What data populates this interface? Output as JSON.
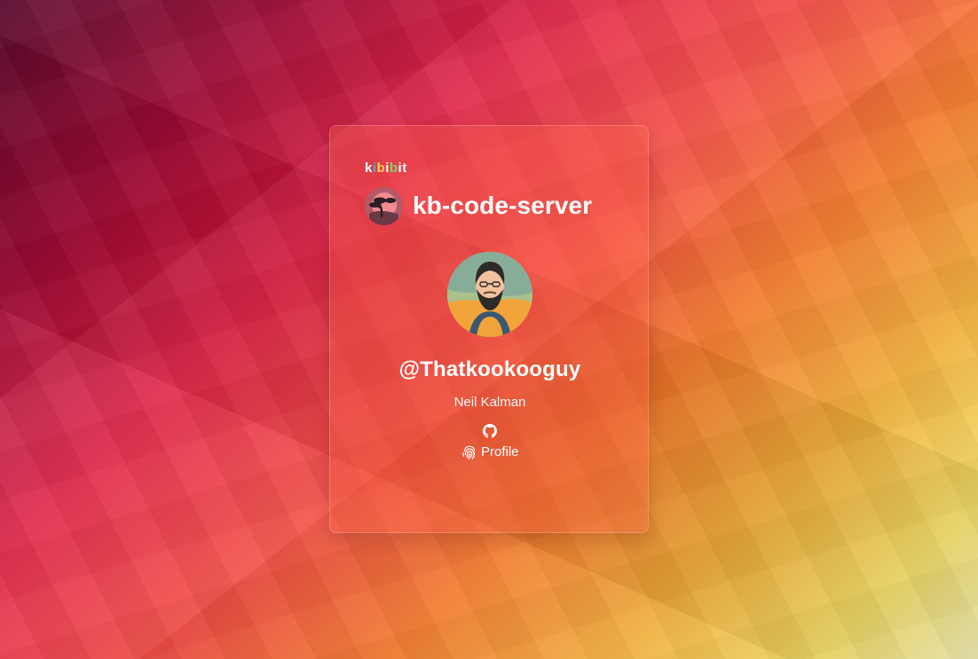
{
  "brand": {
    "letters": [
      "k",
      "i",
      "b",
      "i",
      "b",
      "i",
      "t"
    ]
  },
  "app": {
    "name": "kb-code-server"
  },
  "user": {
    "username": "@Thatkookooguy",
    "full_name": "Neil Kalman"
  },
  "links": {
    "profile_label": "Profile"
  },
  "icons": {
    "app_icon": "bonsai-tree-icon",
    "github_icon": "github-icon",
    "profile_icon": "fingerprint-icon"
  },
  "colors": {
    "card_text": "#ffffff",
    "brand_blue": "#39b5e6",
    "brand_yellow": "#ffd14c",
    "brand_green": "#7bd66b",
    "background_start": "#5e0a2f",
    "background_middle": "#f2453b",
    "background_end": "#fbf7b9"
  }
}
